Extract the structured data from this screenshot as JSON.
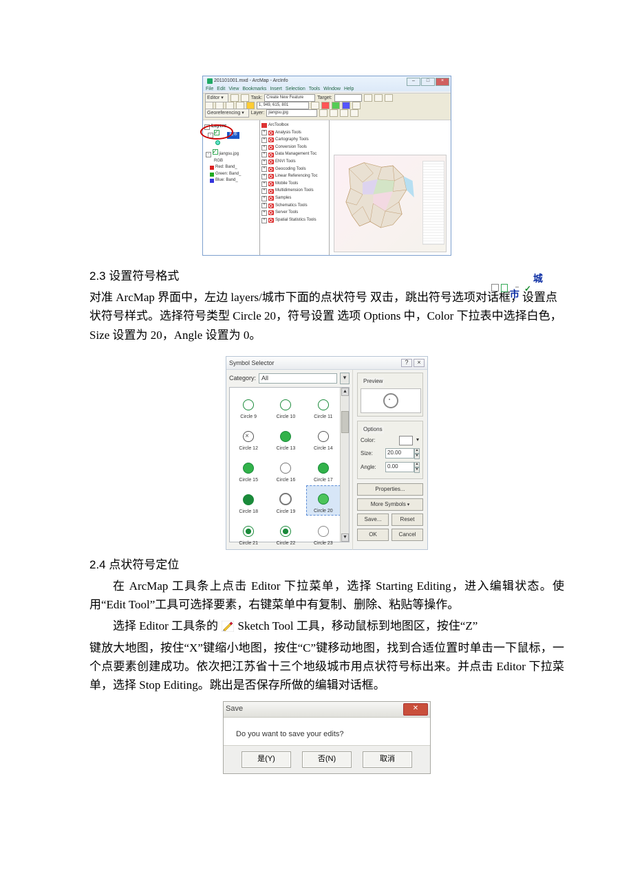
{
  "arcmap": {
    "title_doc": "201101001.mxd - ArcMap - ArcInfo",
    "menus": [
      "File",
      "Edit",
      "View",
      "Bookmarks",
      "Insert",
      "Selection",
      "Tools",
      "Window",
      "Help"
    ],
    "editor_label": "Editor",
    "task_label": "Task:",
    "task_value": "Create New Feature",
    "target_label": "Target:",
    "coords": "1, 949, 615, 801",
    "georef_label": "Georeferencing",
    "georef_layer_label": "Layer:",
    "georef_layer_value": "jiangsu.jpg",
    "toc": {
      "layers_label": "Layers",
      "selected": "城市",
      "raster_item": "jiangsu.jpg",
      "rgb_label": "RGB",
      "bands": [
        {
          "color": "#d22",
          "label": "Red: Band_"
        },
        {
          "color": "#2a2",
          "label": "Green: Band_"
        },
        {
          "color": "#33d",
          "label": "Blue: Band_"
        }
      ]
    },
    "toolbox": {
      "root": "ArcToolbox",
      "items": [
        "Analysis Tools",
        "Cartography Tools",
        "Conversion Tools",
        "Data Management Toc",
        "ENVI Tools",
        "Geocoding Tools",
        "Linear Referencing Toc",
        "Mobile Tools",
        "Multidimension Tools",
        "Samples",
        "Schematics Tools",
        "Server Tools",
        "Spatial Statistics Tools"
      ]
    }
  },
  "section23_head": "2.3  设置符号格式",
  "inline_layers": {
    "label": "城市"
  },
  "para23": "对准 ArcMap 界面中，左边 layers/城市下面的点状符号            双击，跳出符号选项对话框，设置点状符号样式。选择符号类型 Circle 20，符号设置 选项 Options 中，Color 下拉表中选择白色，Size 设置为 20，Angle 设置为 0。",
  "symsel": {
    "title": "Symbol Selector",
    "category_label": "Category:",
    "category_value": "All",
    "preview_label": "Preview",
    "options_label": "Options",
    "color_label": "Color:",
    "size_label": "Size:",
    "size_value": "20.00",
    "angle_label": "Angle:",
    "angle_value": "0.00",
    "buttons": {
      "properties": "Properties...",
      "more": "More Symbols",
      "save": "Save...",
      "reset": "Reset",
      "ok": "OK",
      "cancel": "Cancel"
    },
    "symbols": [
      "Circle 9",
      "Circle 10",
      "Circle 11",
      "Circle 12",
      "Circle 13",
      "Circle 14",
      "Circle 15",
      "Circle 16",
      "Circle 17",
      "Circle 18",
      "Circle 19",
      "Circle 20",
      "Circle 21",
      "Circle 22",
      "Circle 23"
    ],
    "selected_index": 11
  },
  "section24_head": "2.4  点状符号定位",
  "para24a": "在 ArcMap 工具条上点击 Editor 下拉菜单，选择 Starting Editing，进入编辑状态。使用“Edit Tool”工具可选择要素，右键菜单中有复制、删除、粘贴等操作。",
  "para24b_pre": "选择 Editor 工具条的",
  "para24b_post": " Sketch Tool 工具，移动鼠标到地图区，按住“Z”",
  "para24c": "键放大地图，按住“X”键缩小地图，按住“C”键移动地图，找到合适位置时单击一下鼠标，一个点要素创建成功。依次把江苏省十三个地级城市用点状符号标出来。并点击 Editor 下拉菜单，选择 Stop Editing。跳出是否保存所做的编辑对话框。",
  "save": {
    "title": "Save",
    "msg": "Do you want to save your edits?",
    "yes": "是(Y)",
    "no": "否(N)",
    "cancel": "取消"
  }
}
